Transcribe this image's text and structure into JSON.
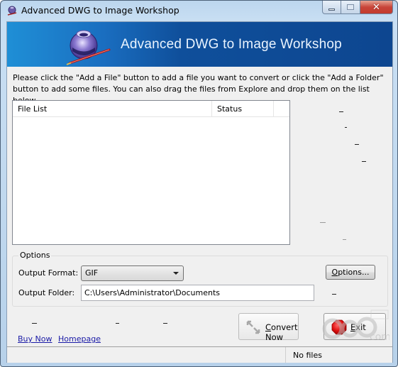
{
  "window": {
    "title": "Advanced DWG to Image Workshop",
    "caption_buttons": [
      "minimize",
      "maximize",
      "close"
    ]
  },
  "banner": {
    "title": "Advanced DWG to Image Workshop",
    "logo_icon": "ink-bottle-pen-icon"
  },
  "instructions": "Please click the \"Add a File\" button to add a file you want to convert or click the \"Add a Folder\" button to add some files. You can also drag the files from Explore and drop them on the list below.",
  "file_list": {
    "columns": [
      "File List",
      "Status"
    ],
    "rows": []
  },
  "options": {
    "group_label": "Options",
    "output_format_label": "Output Format:",
    "output_format_value": "GIF",
    "output_folder_label": "Output Folder:",
    "output_folder_value": "C:\\Users\\Administrator\\Documents",
    "options_button": "Options..."
  },
  "actions": {
    "convert_now": "Convert Now",
    "exit": "Exit"
  },
  "links": {
    "buy_now": "Buy Now",
    "homepage": "Homepage"
  },
  "status": {
    "text": "No files"
  },
  "colors": {
    "banner_start": "#1f8fd6",
    "banner_end": "#0d4690",
    "link": "#1a1aa6",
    "exit_red": "#e01010"
  }
}
